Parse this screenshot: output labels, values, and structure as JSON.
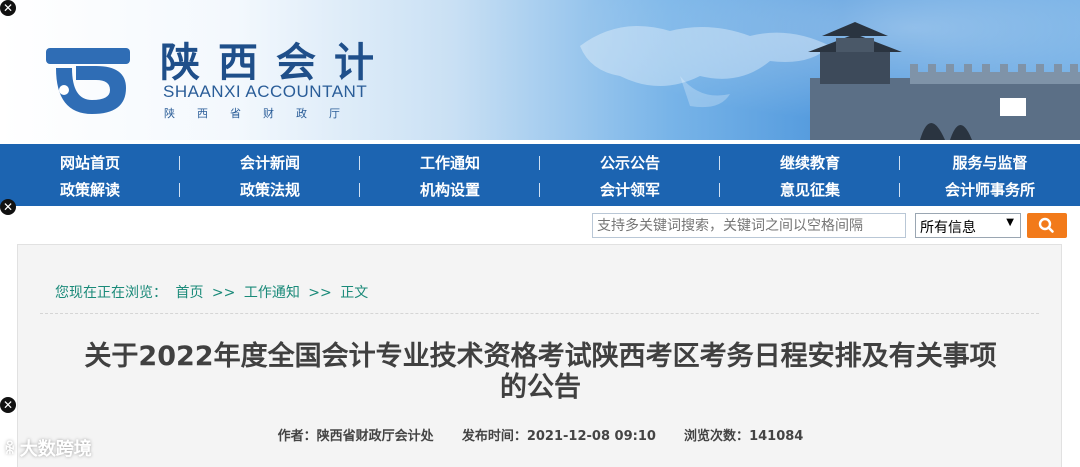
{
  "banner": {
    "logo_cn": "陕西会计",
    "logo_en": "SHAANXI ACCOUNTANT",
    "logo_sub": "陕西省财政厅"
  },
  "nav": {
    "row1": [
      "网站首页",
      "会计新闻",
      "工作通知",
      "公示公告",
      "继续教育",
      "服务与监督"
    ],
    "row2": [
      "政策解读",
      "政策法规",
      "机构设置",
      "会计领军",
      "意见征集",
      "会计师事务所"
    ]
  },
  "search": {
    "placeholder": "支持多关键词搜索，关键词之间以空格间隔",
    "scope_selected": "所有信息",
    "button_icon": "search-icon"
  },
  "breadcrumb": {
    "prefix": "您现在正在浏览：",
    "home": "首页",
    "sep": ">>",
    "section": "工作通知",
    "current": "正文"
  },
  "article": {
    "title_line1": "关于2022年度全国会计专业技术资格考试陕西考区考务日程安排及有关事项",
    "title_line2": "的公告",
    "author_label": "作者：",
    "author": "陕西省财政厅会计处",
    "date_label": "发布时间：",
    "date": "2021-12-08 09:10",
    "views_label": "浏览次数：",
    "views": "141084"
  },
  "watermark": {
    "text": "大数跨境"
  },
  "colors": {
    "nav_bg": "#1c64b1",
    "accent_orange": "#f27a1a",
    "breadcrumb": "#1a8a79"
  }
}
